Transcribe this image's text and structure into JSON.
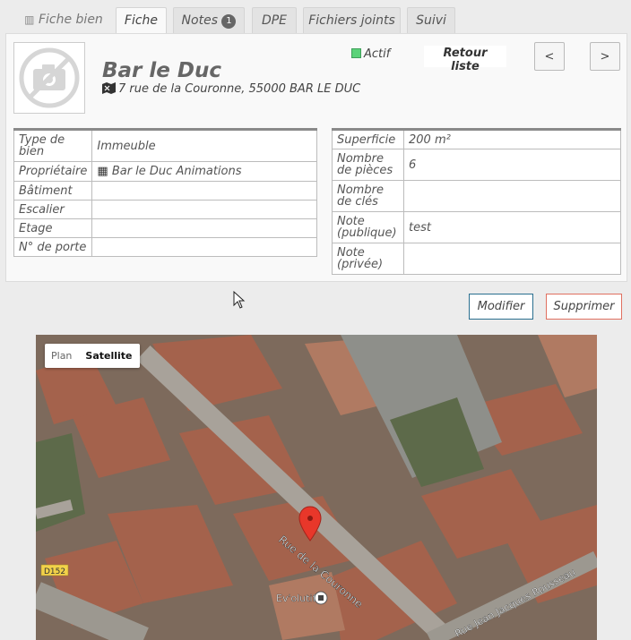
{
  "tabs": [
    {
      "label": "Fiche bien"
    },
    {
      "label": "Fiche"
    },
    {
      "label": "Notes",
      "badge": "1"
    },
    {
      "label": "DPE"
    },
    {
      "label": "Fichiers joints"
    },
    {
      "label": "Suivi"
    }
  ],
  "header": {
    "title": "Bar le Duc",
    "address": "7 rue de la Couronne, 55000 BAR LE DUC",
    "status": "Actif",
    "status_color": "#5bd379",
    "back_label": "Retour liste",
    "prev_label": "<",
    "next_label": ">"
  },
  "left_table": [
    {
      "label": "Type de bien",
      "value": "Immeuble"
    },
    {
      "label": "Propriétaire",
      "value": "Bar le Duc Animations",
      "icon": "building-icon"
    },
    {
      "label": "Bâtiment",
      "value": ""
    },
    {
      "label": "Escalier",
      "value": ""
    },
    {
      "label": "Etage",
      "value": ""
    },
    {
      "label": "N° de porte",
      "value": ""
    }
  ],
  "right_table": [
    {
      "label": "Superficie",
      "value": "200 m²"
    },
    {
      "label": "Nombre de pièces",
      "value": "6"
    },
    {
      "label": "Nombre de clés",
      "value": ""
    },
    {
      "label": "Note (publique)",
      "value": "test"
    },
    {
      "label": "Note (privée)",
      "value": ""
    }
  ],
  "actions": {
    "edit_label": "Modifier",
    "delete_label": "Supprimer"
  },
  "map": {
    "plan_label": "Plan",
    "satellite_label": "Satellite",
    "street_label": "Rue de la Couronne",
    "street2_label": "Rue Jean Jacques Rousseau",
    "road_label": "D152",
    "place_label": "Ev'olutif",
    "marker_color": "#e8372a"
  }
}
